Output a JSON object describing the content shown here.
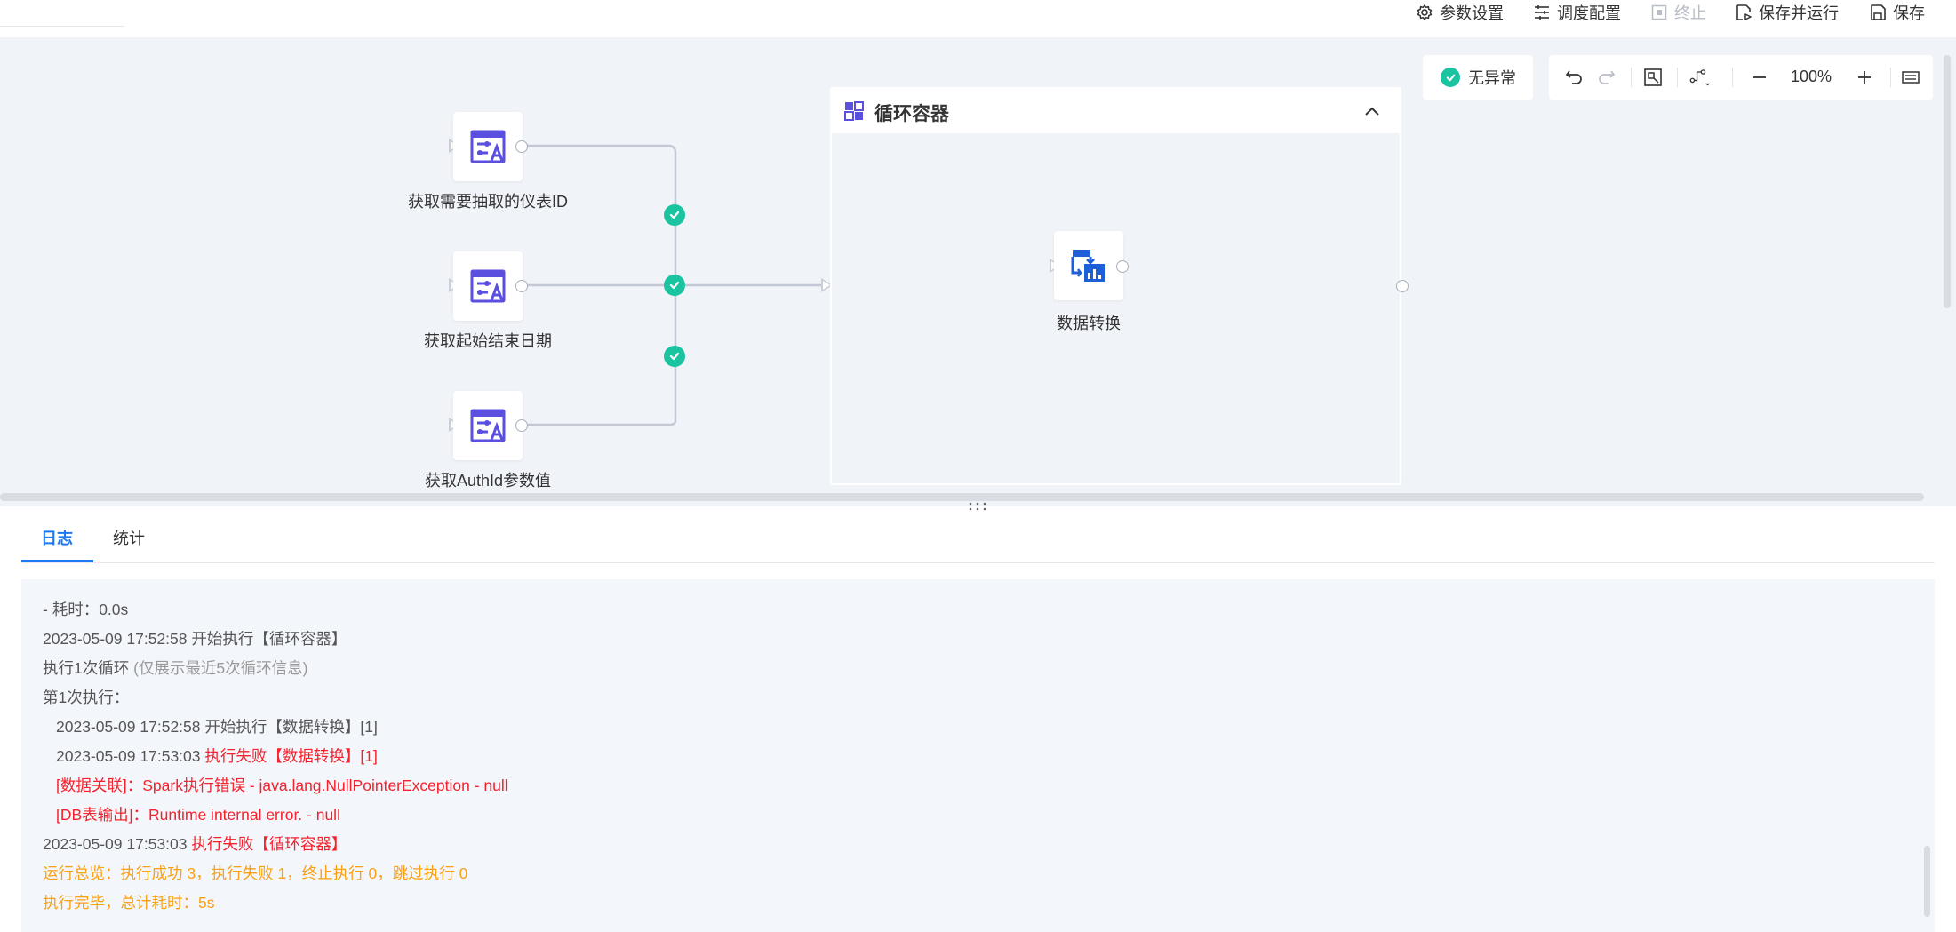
{
  "toolbar": {
    "params_label": "参数设置",
    "schedule_label": "调度配置",
    "stop_label": "终止",
    "save_run_label": "保存并运行",
    "save_label": "保存"
  },
  "canvas": {
    "status_text": "无异常",
    "zoom_level": "100%",
    "nodes": [
      {
        "label": "获取需要抽取的仪表ID"
      },
      {
        "label": "获取起始结束日期"
      },
      {
        "label": "获取AuthId参数值"
      }
    ],
    "loop_container": {
      "title": "循环容器",
      "inner_node_label": "数据转换"
    }
  },
  "panel": {
    "tabs": [
      "日志",
      "统计"
    ],
    "active_tab": "日志",
    "log": {
      "line1": "- 耗时：0.0s",
      "line2": "2023-05-09 17:52:58 开始执行【循环容器】",
      "line3_main": "执行1次循环",
      "line3_note": "(仅展示最近5次循环信息)",
      "line4": "第1次执行：",
      "line5": "2023-05-09 17:52:58 开始执行【数据转换】[1]",
      "line6_time": "2023-05-09 17:53:03",
      "line6_msg": "执行失败【数据转换】[1]",
      "line7": "[数据关联]：Spark执行错误 - java.lang.NullPointerException - null",
      "line8": "[DB表输出]：Runtime internal error. - null",
      "line9_time": "2023-05-09 17:53:03",
      "line9_msg": "执行失败【循环容器】",
      "line10": "运行总览：执行成功 3，执行失败 1，终止执行 0，跳过执行 0",
      "line11": "执行完毕，总计耗时：5s"
    }
  },
  "colors": {
    "accent": "#1d79f2",
    "success": "#1bc4a0",
    "error": "#f5222d",
    "warning": "#faa014",
    "node_icon": "#5b4fe0"
  }
}
